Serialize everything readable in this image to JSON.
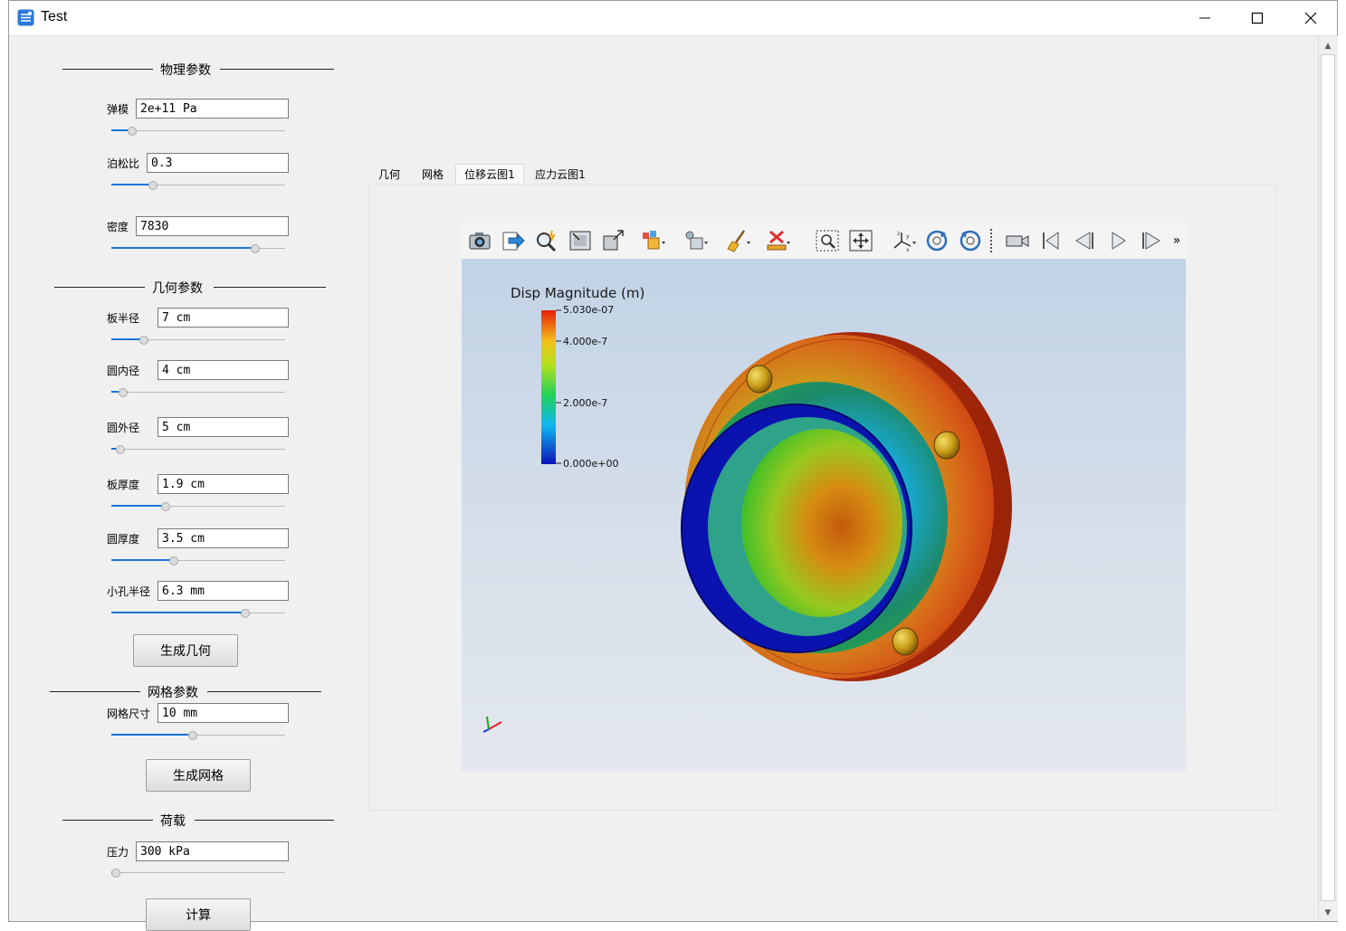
{
  "window": {
    "title": "Test"
  },
  "sections": {
    "physics": "物理参数",
    "geometry": "几何参数",
    "mesh": "网格参数",
    "load": "荷载"
  },
  "params": {
    "elastic_modulus": {
      "label": "弹模",
      "value": "2e+11 Pa",
      "slider": 0.12
    },
    "poisson": {
      "label": "泊松比",
      "value": "0.3",
      "slider": 0.24
    },
    "density": {
      "label": "密度",
      "value": "7830",
      "slider": 0.83
    },
    "plate_radius": {
      "label": "板半径",
      "value": "7 cm",
      "slider": 0.19
    },
    "ring_inner": {
      "label": "圆内径",
      "value": "4 cm",
      "slider": 0.07
    },
    "ring_outer": {
      "label": "圆外径",
      "value": "5 cm",
      "slider": 0.05
    },
    "plate_thickness": {
      "label": "板厚度",
      "value": "1.9 cm",
      "slider": 0.31
    },
    "ring_thickness": {
      "label": "圆厚度",
      "value": "3.5 cm",
      "slider": 0.36
    },
    "hole_radius": {
      "label": "小孔半径",
      "value": "6.3 mm",
      "slider": 0.77
    },
    "mesh_size": {
      "label": "网格尺寸",
      "value": "10 mm",
      "slider": 0.47
    },
    "pressure": {
      "label": "压力",
      "value": "300 kPa",
      "slider": 0.0
    }
  },
  "buttons": {
    "gen_geometry": "生成几何",
    "gen_mesh": "生成网格",
    "compute": "计算"
  },
  "tabs": [
    {
      "label": "几何",
      "active": false
    },
    {
      "label": "网格",
      "active": false
    },
    {
      "label": "位移云图1",
      "active": true
    },
    {
      "label": "应力云图1",
      "active": false
    }
  ],
  "toolbar_icons": [
    "camera-icon",
    "export-icon",
    "magic-zoom-icon",
    "fit-view-icon",
    "expand-icon",
    "render-mode-icon",
    "display-mode-icon",
    "clean-icon",
    "delete-icon",
    "zoom-box-icon",
    "pan-icon",
    "axes-icon",
    "rotate-cw-icon",
    "rotate-ccw-icon",
    "video-icon",
    "first-frame-icon",
    "prev-frame-icon",
    "play-icon",
    "next-frame-icon",
    "more-icon"
  ],
  "toolbar_more": "»",
  "colorbar": {
    "title": "Disp Magnitude (m)",
    "ticks": [
      "5.030e-07",
      "4.000e-7",
      "2.000e-7",
      "0.000e+00"
    ]
  },
  "axes": {
    "x": "x",
    "y": "y",
    "z": "z"
  },
  "colors": {
    "accent": "#1874d8",
    "min": "#0a13b8",
    "max": "#e81e0b"
  }
}
